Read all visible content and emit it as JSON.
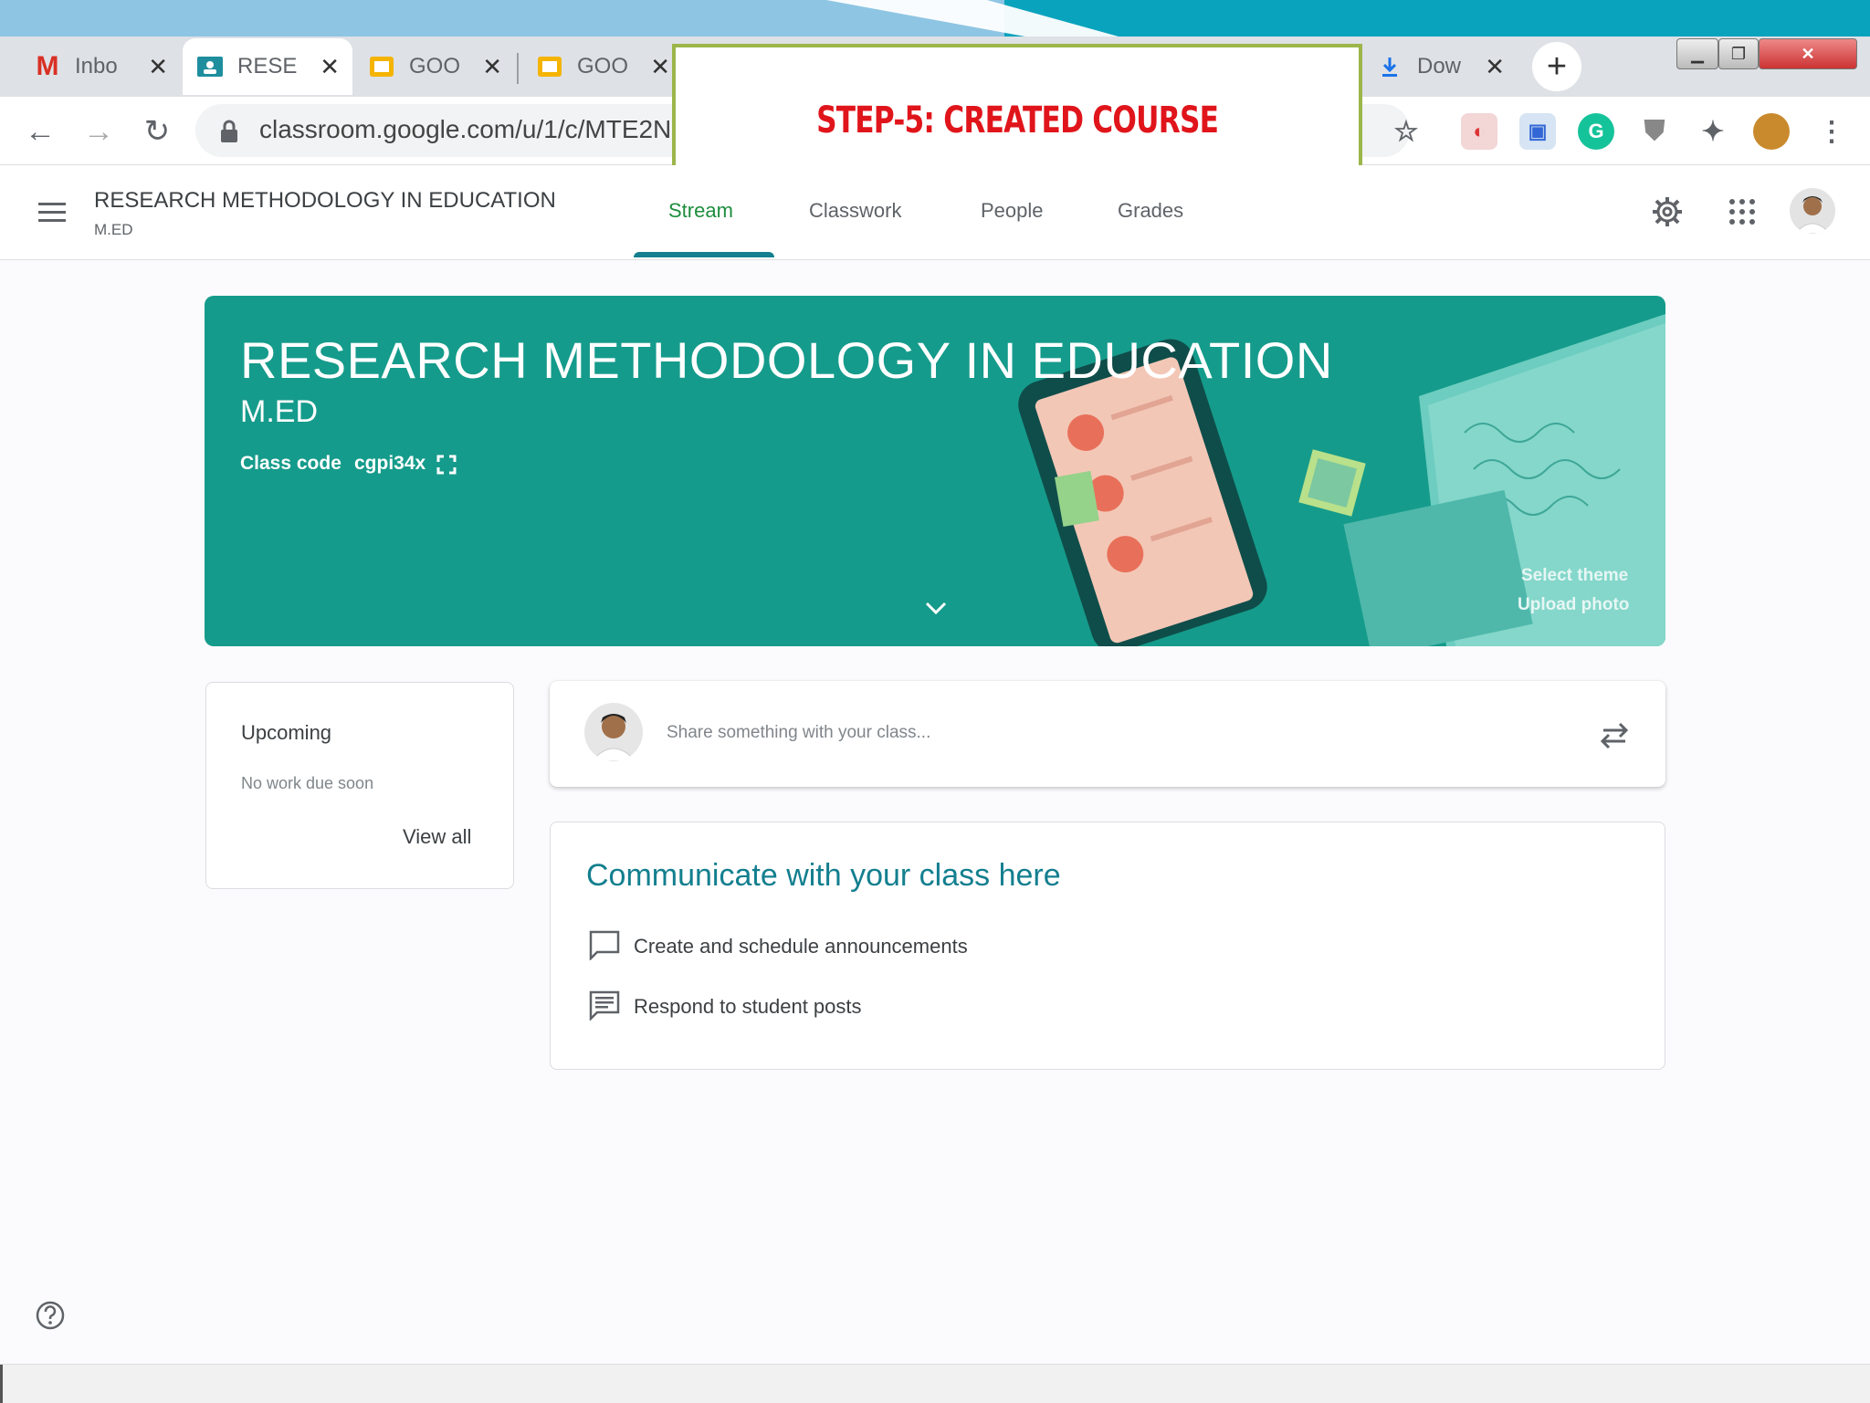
{
  "overlay": {
    "step_caption": "STEP-5: CREATED COURSE"
  },
  "browser": {
    "tabs": [
      {
        "label": "Inbo",
        "icon": "gmail-icon"
      },
      {
        "label": "RESE",
        "icon": "classroom-icon"
      },
      {
        "label": "GOO",
        "icon": "slides-icon"
      },
      {
        "label": "GOO",
        "icon": "slides-icon"
      },
      {
        "label": "Dow",
        "icon": "download-icon"
      }
    ],
    "url": "classroom.google.com/u/1/c/MTE2N",
    "new_tab": "+"
  },
  "app": {
    "class_name": "RESEARCH METHODOLOGY IN EDUCATION",
    "section": "M.ED",
    "nav_tabs": [
      "Stream",
      "Classwork",
      "People",
      "Grades"
    ],
    "active_tab": "Stream"
  },
  "banner": {
    "title": "RESEARCH METHODOLOGY IN EDUCATION",
    "section": "M.ED",
    "class_code_label": "Class code",
    "class_code": "cgpi34x",
    "select_theme": "Select theme",
    "upload_photo": "Upload photo"
  },
  "upcoming": {
    "title": "Upcoming",
    "empty_text": "No work due soon",
    "view_all": "View all"
  },
  "share": {
    "placeholder": "Share something with your class..."
  },
  "communicate": {
    "title": "Communicate with your class here",
    "items": [
      "Create and schedule announcements",
      "Respond to student posts"
    ]
  },
  "colors": {
    "accent": "#137f8f",
    "banner": "#159b8b",
    "caption": "#e0151b"
  }
}
